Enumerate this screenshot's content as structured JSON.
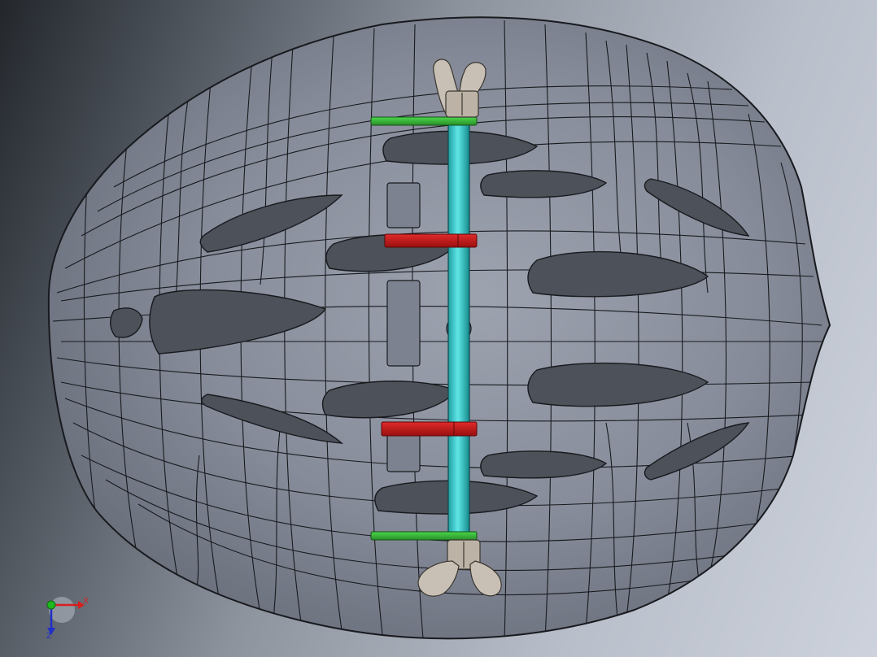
{
  "viewport": {
    "background_left": "#23272c",
    "background_right": "#cdd2dc",
    "helmet_color": "#868b99",
    "helmet_edge_color": "#181a1e"
  },
  "parts": [
    {
      "name": "helmet-shell",
      "icon": "helmet-icon",
      "color": "#868b99"
    },
    {
      "name": "axle-rod",
      "icon": "rod-icon",
      "color": "#2fc4c6"
    },
    {
      "name": "green-washer-top",
      "icon": "washer-icon",
      "color": "#3ab53a"
    },
    {
      "name": "green-washer-bottom",
      "icon": "washer-icon",
      "color": "#3ab53a"
    },
    {
      "name": "red-clip-upper",
      "icon": "clip-icon",
      "color": "#c01818"
    },
    {
      "name": "red-clip-lower",
      "icon": "clip-icon",
      "color": "#c01818"
    },
    {
      "name": "wing-nut-top",
      "icon": "wing-nut-icon",
      "color": "#c8c0b4"
    },
    {
      "name": "wing-nut-bottom",
      "icon": "wing-nut-icon",
      "color": "#c8c0b4"
    }
  ],
  "triad": {
    "x_label": "X",
    "z_label": "Z",
    "x_color": "#d81f1f",
    "y_color": "#1fb81f",
    "z_color": "#1f2fc8"
  }
}
